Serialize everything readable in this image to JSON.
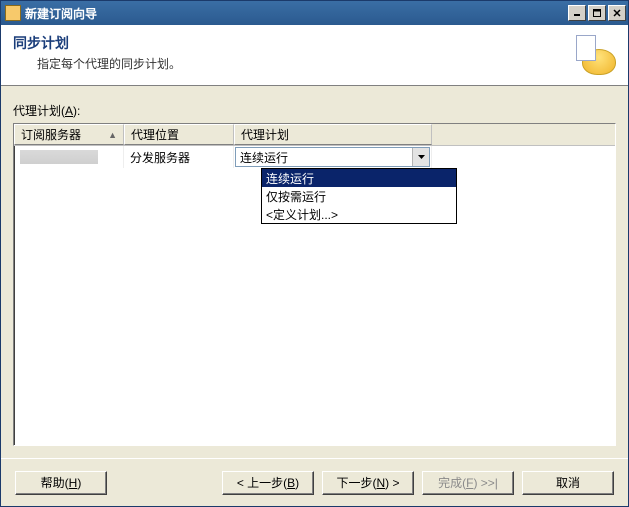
{
  "window": {
    "title": "新建订阅向导"
  },
  "header": {
    "title": "同步计划",
    "subtitle": "指定每个代理的同步计划。"
  },
  "section": {
    "label_prefix": "代理计划(",
    "label_accel": "A",
    "label_suffix": "):"
  },
  "grid": {
    "col1": "订阅服务器",
    "col2": "代理位置",
    "col3": "代理计划",
    "row1": {
      "agent_location": "分发服务器"
    }
  },
  "combo": {
    "selected": "连续运行",
    "options": [
      "连续运行",
      "仅按需运行",
      "<定义计划...>"
    ]
  },
  "buttons": {
    "help_pre": "帮助(",
    "help_accel": "H",
    "help_post": ")",
    "back_pre": "< 上一步(",
    "back_accel": "B",
    "back_post": ")",
    "next_pre": "下一步(",
    "next_accel": "N",
    "next_post": ") >",
    "finish_pre": "完成(",
    "finish_accel": "F",
    "finish_post": ") >>|",
    "cancel": "取消"
  }
}
